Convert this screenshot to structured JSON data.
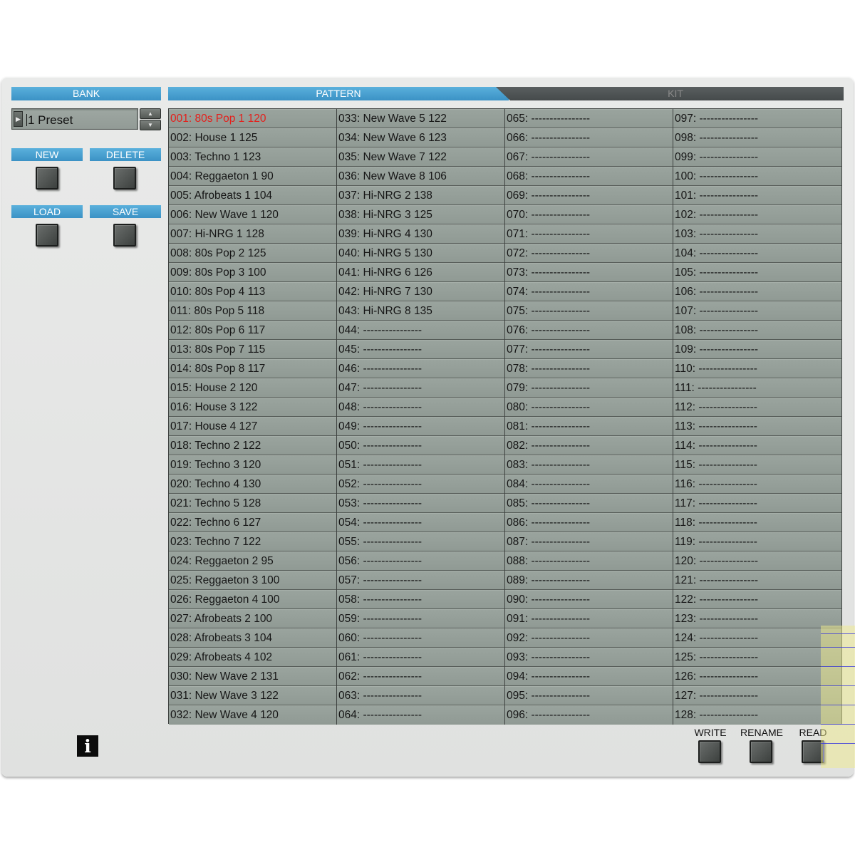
{
  "bank": {
    "header": "BANK",
    "selected": "1 Preset",
    "buttons": {
      "new": "NEW",
      "delete": "DELETE",
      "load": "LOAD",
      "save": "SAVE"
    }
  },
  "tabs": {
    "pattern": "PATTERN",
    "kit": "KIT"
  },
  "active_pattern": "001: 80s Pop 1 120",
  "patterns": [
    [
      "001: 80s Pop 1 120",
      "002: House 1 125",
      "003: Techno 1 123",
      "004: Reggaeton 1 90",
      "005: Afrobeats 1 104",
      "006: New Wave 1 120",
      "007: Hi-NRG 1 128",
      "008: 80s Pop 2 125",
      "009: 80s Pop 3 100",
      "010: 80s Pop 4 113",
      "011: 80s Pop 5 118",
      "012: 80s Pop 6 117",
      "013: 80s Pop 7 115",
      "014: 80s Pop 8 117",
      "015: House 2 120",
      "016: House 3 122",
      "017: House 4 127",
      "018: Techno 2 122",
      "019: Techno 3 120",
      "020: Techno 4 130",
      "021: Techno 5 128",
      "022: Techno 6 127",
      "023: Techno 7 122",
      "024: Reggaeton 2 95",
      "025: Reggaeton 3 100",
      "026: Reggaeton 4 100",
      "027: Afrobeats 2 100",
      "028: Afrobeats 3 104",
      "029: Afrobeats 4 102",
      "030: New Wave 2 131",
      "031: New Wave 3 122",
      "032: New Wave 4 120"
    ],
    [
      "033: New Wave 5 122",
      "034: New Wave 6 123",
      "035: New Wave 7 122",
      "036: New Wave 8 106",
      "037: Hi-NRG 2 138",
      "038: Hi-NRG 3 125",
      "039: Hi-NRG 4 130",
      "040: Hi-NRG 5 130",
      "041: Hi-NRG 6 126",
      "042: Hi-NRG 7 130",
      "043: Hi-NRG 8 135",
      "044: ----------------",
      "045: ----------------",
      "046: ----------------",
      "047: ----------------",
      "048: ----------------",
      "049: ----------------",
      "050: ----------------",
      "051: ----------------",
      "052: ----------------",
      "053: ----------------",
      "054: ----------------",
      "055: ----------------",
      "056: ----------------",
      "057: ----------------",
      "058: ----------------",
      "059: ----------------",
      "060: ----------------",
      "061: ----------------",
      "062: ----------------",
      "063: ----------------",
      "064: ----------------"
    ],
    [
      "065: ----------------",
      "066: ----------------",
      "067: ----------------",
      "068: ----------------",
      "069: ----------------",
      "070: ----------------",
      "071: ----------------",
      "072: ----------------",
      "073: ----------------",
      "074: ----------------",
      "075: ----------------",
      "076: ----------------",
      "077: ----------------",
      "078: ----------------",
      "079: ----------------",
      "080: ----------------",
      "081: ----------------",
      "082: ----------------",
      "083: ----------------",
      "084: ----------------",
      "085: ----------------",
      "086: ----------------",
      "087: ----------------",
      "088: ----------------",
      "089: ----------------",
      "090: ----------------",
      "091: ----------------",
      "092: ----------------",
      "093: ----------------",
      "094: ----------------",
      "095: ----------------",
      "096: ----------------"
    ],
    [
      "097: ----------------",
      "098: ----------------",
      "099: ----------------",
      "100: ----------------",
      "101: ----------------",
      "102: ----------------",
      "103: ----------------",
      "104: ----------------",
      "105: ----------------",
      "106: ----------------",
      "107: ----------------",
      "108: ----------------",
      "109: ----------------",
      "110: ----------------",
      "111: ----------------",
      "112: ----------------",
      "113: ----------------",
      "114: ----------------",
      "115: ----------------",
      "116: ----------------",
      "117: ----------------",
      "118: ----------------",
      "119: ----------------",
      "120: ----------------",
      "121: ----------------",
      "122: ----------------",
      "123: ----------------",
      "124: ----------------",
      "125: ----------------",
      "126: ----------------",
      "127: ----------------",
      "128: ----------------"
    ]
  ],
  "actions": {
    "write": "WRITE",
    "rename": "RENAME",
    "read": "READ"
  },
  "icons": {
    "info": "info-icon",
    "bank_arrow": "play-arrow-icon",
    "spin_up": "arrow-up-icon",
    "spin_down": "arrow-down-icon"
  },
  "colors": {
    "accent": "#3b92c5",
    "active_text": "#e4201c",
    "lcd": "#96a19a"
  }
}
